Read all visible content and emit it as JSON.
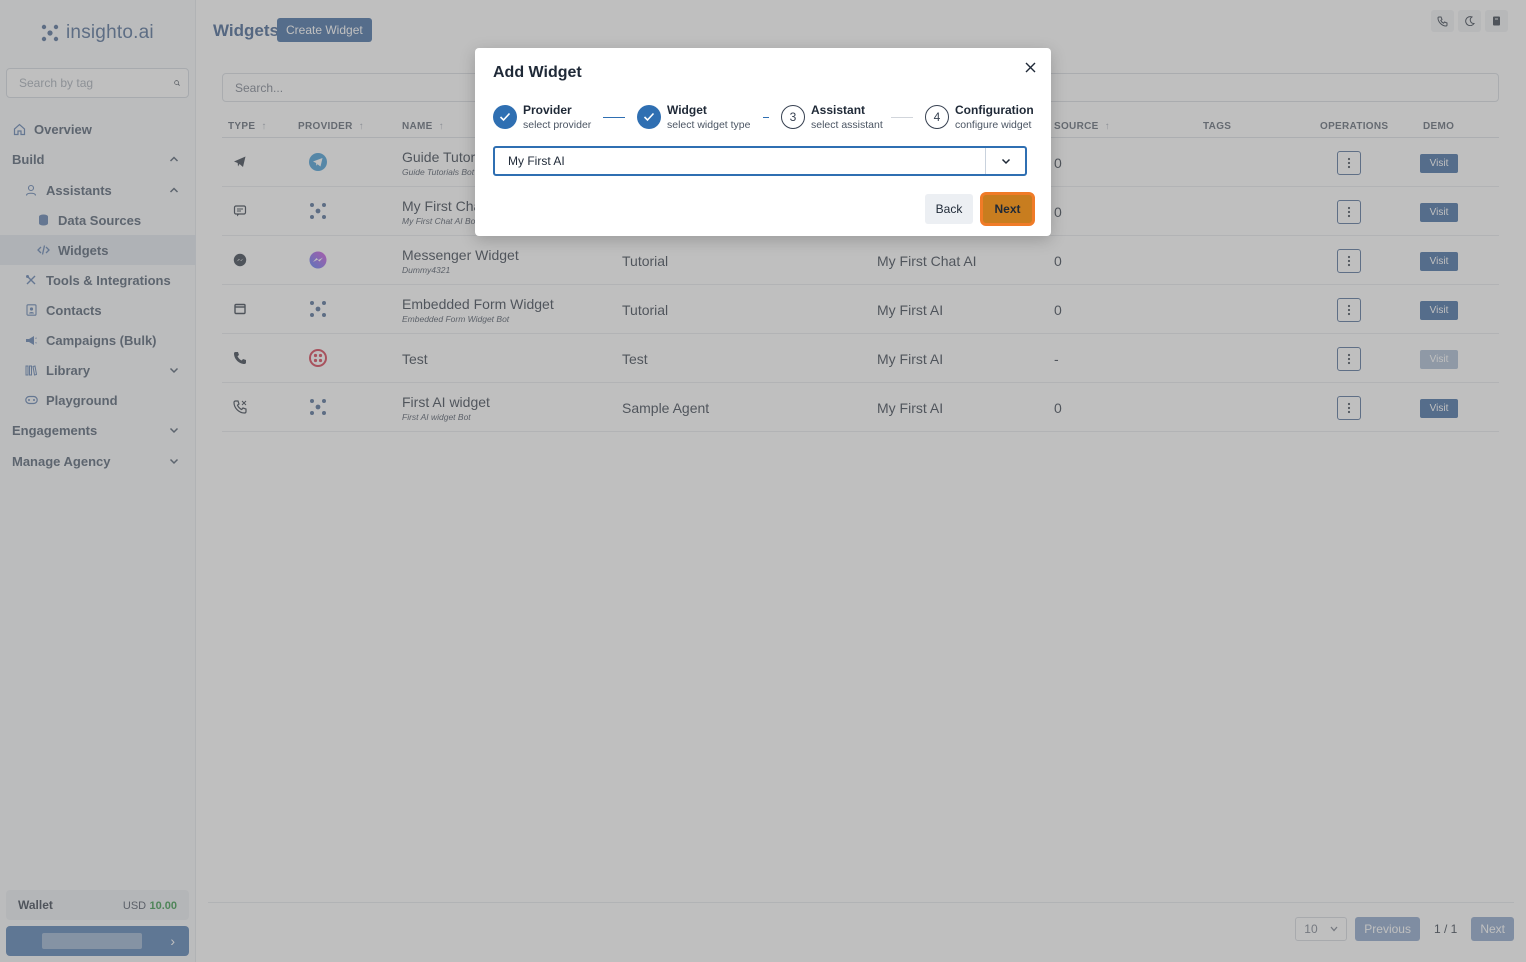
{
  "brand": {
    "name": "insighto.ai"
  },
  "sidebar": {
    "search_placeholder": "Search by tag",
    "items": [
      {
        "label": "Overview",
        "icon": "home-icon"
      },
      {
        "label": "Build",
        "icon": ""
      },
      {
        "label": "Assistants",
        "icon": "user-icon"
      },
      {
        "label": "Data Sources",
        "icon": "database-icon"
      },
      {
        "label": "Widgets",
        "icon": "code-icon"
      },
      {
        "label": "Tools & Integrations",
        "icon": "tools-icon"
      },
      {
        "label": "Contacts",
        "icon": "contacts-icon"
      },
      {
        "label": "Campaigns (Bulk)",
        "icon": "megaphone-icon"
      },
      {
        "label": "Library",
        "icon": "library-icon"
      },
      {
        "label": "Playground",
        "icon": "gamepad-icon"
      },
      {
        "label": "Engagements",
        "icon": ""
      },
      {
        "label": "Manage Agency",
        "icon": ""
      }
    ],
    "wallet": {
      "label": "Wallet",
      "currency": "USD",
      "amount": "10.00"
    }
  },
  "header": {
    "title": "Widgets",
    "create_label": "Create Widget"
  },
  "main": {
    "search_placeholder": "Search..."
  },
  "table": {
    "columns": [
      "TYPE",
      "PROVIDER",
      "NAME",
      "SOURCE",
      "TAGS",
      "OPERATIONS",
      "DEMO"
    ],
    "rows": [
      {
        "type_icon": "telegram-icon",
        "provider_icon": "telegram-provider-icon",
        "name": "Guide Tutori",
        "sub": "Guide Tutorials Bot",
        "agent": "",
        "assistant": "",
        "source": "0",
        "visit": "Visit"
      },
      {
        "type_icon": "chat-icon",
        "provider_icon": "insighto-provider-icon",
        "name": "My First Cha",
        "sub": "My First Chat AI Bo",
        "agent": "",
        "assistant": "",
        "source": "0",
        "visit": "Visit"
      },
      {
        "type_icon": "messenger-icon",
        "provider_icon": "messenger-provider-icon",
        "name": "Messenger Widget",
        "sub": "Dummy4321",
        "agent": "Tutorial",
        "assistant": "My First Chat AI",
        "source": "0",
        "visit": "Visit"
      },
      {
        "type_icon": "form-icon",
        "provider_icon": "insighto-provider-icon",
        "name": "Embedded Form Widget",
        "sub": "Embedded Form Widget Bot",
        "agent": "Tutorial",
        "assistant": "My First AI",
        "source": "0",
        "visit": "Visit"
      },
      {
        "type_icon": "phone-icon",
        "provider_icon": "twilio-provider-icon",
        "name": "Test",
        "sub": "",
        "agent": "Test",
        "assistant": "My First AI",
        "source": "-",
        "visit": "Visit"
      },
      {
        "type_icon": "phone-call-icon",
        "provider_icon": "insighto-provider-icon",
        "name": "First AI widget",
        "sub": "First AI widget Bot",
        "agent": "Sample Agent",
        "assistant": "My First AI",
        "source": "0",
        "visit": "Visit"
      }
    ]
  },
  "pagination": {
    "page_size": "10",
    "previous": "Previous",
    "page_info": "1  /  1",
    "next": "Next"
  },
  "modal": {
    "title": "Add Widget",
    "steps": [
      {
        "title": "Provider",
        "sub": "select provider",
        "number": "1"
      },
      {
        "title": "Widget",
        "sub": "select widget type",
        "number": "2"
      },
      {
        "title": "Assistant",
        "sub": "select assistant",
        "number": "3"
      },
      {
        "title": "Configuration",
        "sub": "configure widget",
        "number": "4"
      }
    ],
    "selected_assistant": "My First AI",
    "back_label": "Back",
    "next_label": "Next"
  },
  "colors": {
    "primary": "#2a5a97",
    "step_done": "#2f6fb2",
    "next_highlight": "#f07b27"
  }
}
